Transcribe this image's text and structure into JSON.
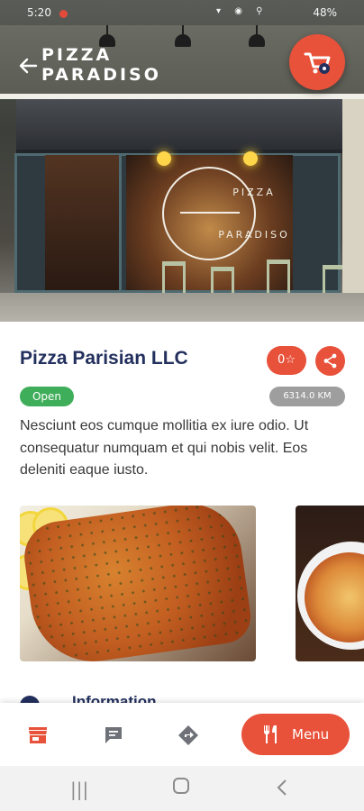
{
  "status_bar": {
    "time": "5:20",
    "battery": "48%"
  },
  "header": {
    "logo_line1": "PIZZA",
    "logo_line2": "PARADISO"
  },
  "hero": {
    "sign_top": "PIZZA",
    "sign_bottom": "PARADISO"
  },
  "restaurant": {
    "name": "Pizza Parisian LLC",
    "rating_label": "0",
    "status": "Open",
    "distance": "6314.0 KM",
    "description": "Nesciunt eos cumque mollitia ex iure odio. Ut consequatur numquam et qui nobis velit. Eos deleniti eaque iusto."
  },
  "section": {
    "information_label": "Information"
  },
  "bottom_nav": {
    "menu_label": "Menu"
  },
  "colors": {
    "accent": "#e8513a",
    "navy": "#23305e",
    "open_green": "#3fae5a",
    "distance_gray": "#9e9e9e"
  },
  "icons": {
    "back": "arrow-left-icon",
    "cart": "cart-icon",
    "rating": "star-icon",
    "share": "share-icon",
    "store": "store-icon",
    "chat": "chat-icon",
    "directions": "directions-icon",
    "menu": "cutlery-icon",
    "info": "info-icon"
  }
}
